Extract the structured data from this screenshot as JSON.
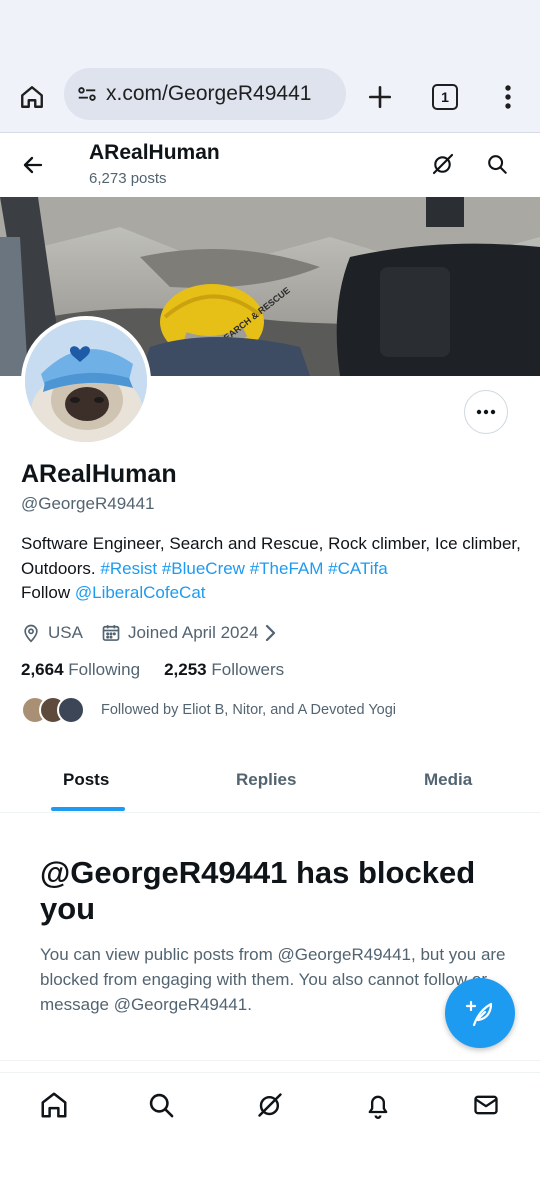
{
  "browser": {
    "url": "x.com/GeorgeR49441",
    "tab_count": "1"
  },
  "header": {
    "display_name": "ARealHuman",
    "post_count": "6,273 posts"
  },
  "profile": {
    "display_name": "ARealHuman",
    "handle": "@GeorgeR49441",
    "bio": {
      "text": "Software Engineer, Search and Rescue, Rock climber, Ice climber, Outdoors.",
      "hashtags": [
        "#Resist",
        "#BlueCrew",
        "#TheFAM",
        "#CATifa"
      ],
      "follow_prefix": "Follow",
      "mention": "@LiberalCofeCat"
    },
    "location": "USA",
    "joined": "Joined April 2024",
    "following_count": "2,664",
    "following_label": "Following",
    "followers_count": "2,253",
    "followers_label": "Followers",
    "followed_by": "Followed by Eliot B, Nitor, and A Devoted Yogi",
    "banner_helmet_text": "SEARCH & RESCUE"
  },
  "tabs": [
    {
      "label": "Posts",
      "active": true
    },
    {
      "label": "Replies",
      "active": false
    },
    {
      "label": "Media",
      "active": false
    }
  ],
  "blocked": {
    "title": "@GeorgeR49441 has blocked you",
    "body": "You can view public posts from @GeorgeR49441, but you are blocked from engaging with them. You also cannot follow or message @GeorgeR49441."
  },
  "colors": {
    "accent": "#1d9bf0",
    "text_primary": "#0f1419",
    "text_secondary": "#536471",
    "browser_chrome": "#f0f2fa"
  },
  "icons": {
    "browser": [
      "home-icon",
      "site-settings-icon",
      "plus-icon",
      "tab-switcher-icon",
      "kebab-menu-icon"
    ],
    "header": [
      "back-arrow-icon",
      "grok-icon",
      "search-icon"
    ],
    "profile": [
      "more-icon",
      "location-pin-icon",
      "calendar-icon",
      "chevron-right-icon"
    ],
    "fab": "compose-post-icon",
    "bottom_nav": [
      "home-icon",
      "search-icon",
      "grok-icon",
      "notifications-bell-icon",
      "messages-envelope-icon"
    ]
  }
}
